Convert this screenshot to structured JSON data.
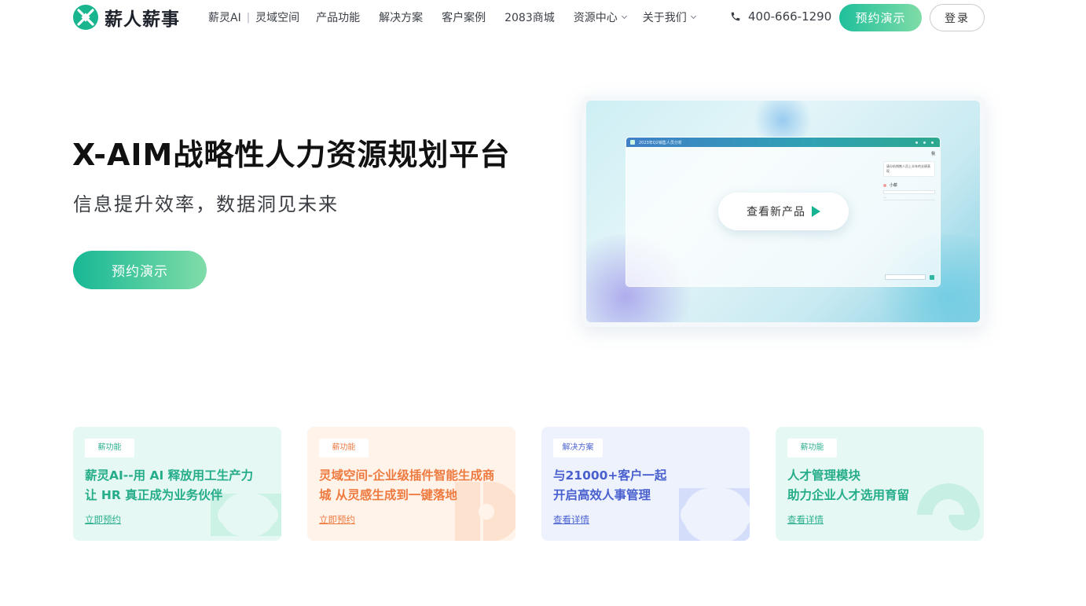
{
  "header": {
    "brand": "薪人薪事",
    "nav": [
      {
        "label": "薪灵AI"
      },
      {
        "label": "灵域空间"
      },
      {
        "label": "产品功能"
      },
      {
        "label": "解决方案"
      },
      {
        "label": "客户案例"
      },
      {
        "label": "2083商城"
      },
      {
        "label": "资源中心",
        "has_dropdown": true
      },
      {
        "label": "关于我们",
        "has_dropdown": true
      }
    ],
    "nav_separator": "|",
    "phone": "400-666-1290",
    "demo_button": "预约演示",
    "login_button": "登录"
  },
  "hero": {
    "title": "X-AIM战略性人力资源规划平台",
    "subtitle": "信息提升效率，数据洞见未来",
    "cta": "预约演示"
  },
  "video": {
    "play_label": "查看新产品",
    "window_title": "2023年Q2销售人员分析",
    "chat_user": "我",
    "chat_question": "请分析销售人员上半年的业绩表现",
    "chat_bot": "小薪",
    "chat_typing": "···"
  },
  "cards": [
    {
      "tag": "薪功能",
      "title": "薪灵AI--用 AI 释放用工生产力\n让 HR 真正成为业务伙伴",
      "link": "立即预约"
    },
    {
      "tag": "薪功能",
      "title": "灵域空间-企业级插件智能生成商\n城 从灵感生成到一键落地",
      "link": "立即预约"
    },
    {
      "tag": "解决方案",
      "title": "与21000+客户一起\n开启高效人事管理",
      "link": "查看详情"
    },
    {
      "tag": "薪功能",
      "title": "人才管理模块\n助力企业人才选用育留",
      "link": "查看详情"
    }
  ],
  "colors": {
    "brand_green": "#1fbf9b",
    "accent_orange": "#ee7a3f",
    "accent_blue": "#4a60cf"
  },
  "icons": {
    "logo": "xinrenxinshi-logo-icon",
    "phone": "phone-icon",
    "play": "play-icon",
    "dropdown": "chevron-down-icon"
  }
}
